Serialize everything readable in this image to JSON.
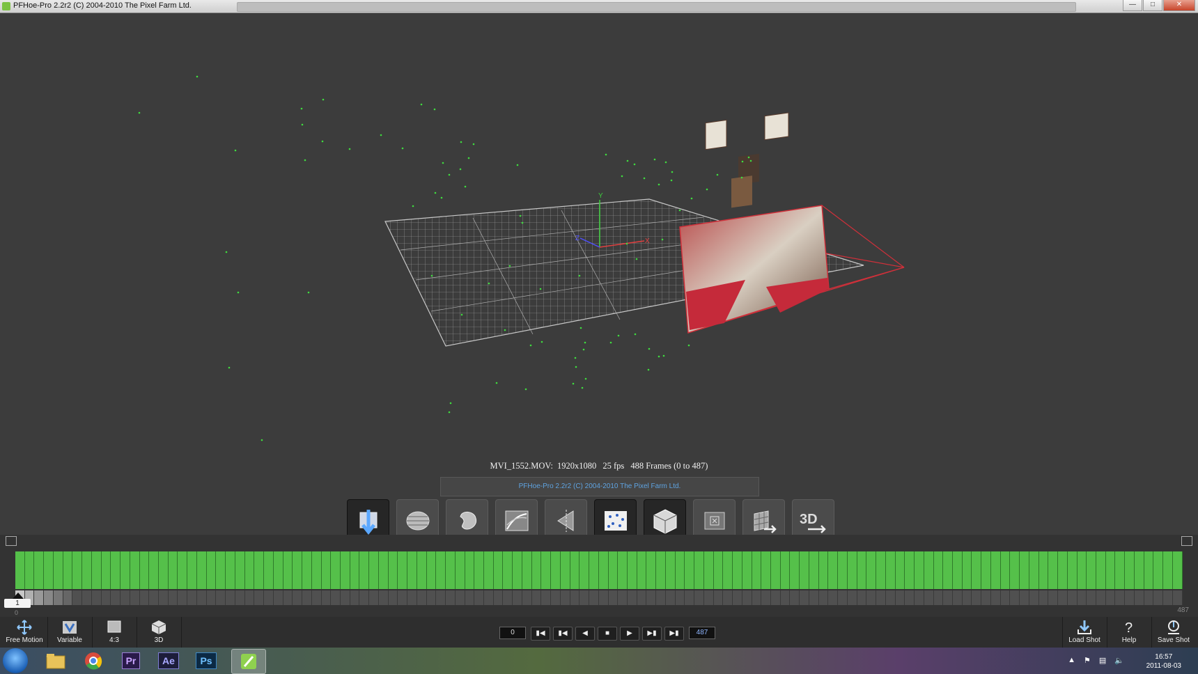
{
  "window": {
    "title": "PFHoe-Pro 2.2r2 (C) 2004-2010 The Pixel Farm Ltd.",
    "controls": [
      "minimize",
      "maximize",
      "close"
    ]
  },
  "viewport": {
    "axis_labels": {
      "y": "Y",
      "z": "Z",
      "x": "X"
    },
    "track_point_color": "#3fdc3f",
    "camera_frame_color": "#d0303a"
  },
  "shot_info": {
    "clip": "MVI_1552.MOV:",
    "resolution": "1920x1080",
    "fps": "25 fps",
    "frames": "488 Frames (0 to 487)"
  },
  "status": {
    "text": "PFHoe-Pro 2.2r2 (C) 2004-2010 The Pixel Farm Ltd."
  },
  "node_buttons": [
    {
      "name": "clip-input-node-button",
      "icon": "import-arrow-icon",
      "active": true
    },
    {
      "name": "lens-distortion-node-button",
      "icon": "lens-icon",
      "active": false
    },
    {
      "name": "mask-node-button",
      "icon": "mask-blob-icon",
      "active": false
    },
    {
      "name": "auto-track-node-button",
      "icon": "track-curve-icon",
      "active": false
    },
    {
      "name": "user-track-node-button",
      "icon": "track-diamond-icon",
      "active": false
    },
    {
      "name": "point-cloud-node-button",
      "icon": "point-cloud-icon",
      "active": true
    },
    {
      "name": "camera-solver-node-button",
      "icon": "cube-icon",
      "active": true
    },
    {
      "name": "test-object-node-button",
      "icon": "target-square-icon",
      "active": false
    },
    {
      "name": "export-scene-node-button",
      "icon": "export-grid-icon",
      "active": false
    },
    {
      "name": "export-3d-node-button",
      "icon": "3d-export-icon",
      "active": false,
      "label": "3D"
    }
  ],
  "timeline": {
    "current_frame": "1",
    "start_tick": "0",
    "end_tick": "487",
    "cached_color": "#55c04a"
  },
  "bottom_tools": {
    "free_motion": "Free Motion",
    "variable": "Variable",
    "aspect": "4:3",
    "view_3d": "3D",
    "load_shot": "Load Shot",
    "help": "Help",
    "save_shot": "Save Shot"
  },
  "transport": {
    "start_frame": "0",
    "end_frame": "487",
    "buttons": [
      "first",
      "prev-key",
      "play-back",
      "stop",
      "play",
      "next-key",
      "last"
    ]
  },
  "taskbar": {
    "apps": [
      {
        "name": "explorer",
        "label": ""
      },
      {
        "name": "chrome",
        "label": ""
      },
      {
        "name": "premiere",
        "label": "Pr"
      },
      {
        "name": "after-effects",
        "label": "Ae"
      },
      {
        "name": "photoshop",
        "label": "Ps"
      },
      {
        "name": "pfhoe",
        "label": "",
        "active": true
      }
    ],
    "time": "16:57",
    "date": "2011-08-03"
  }
}
